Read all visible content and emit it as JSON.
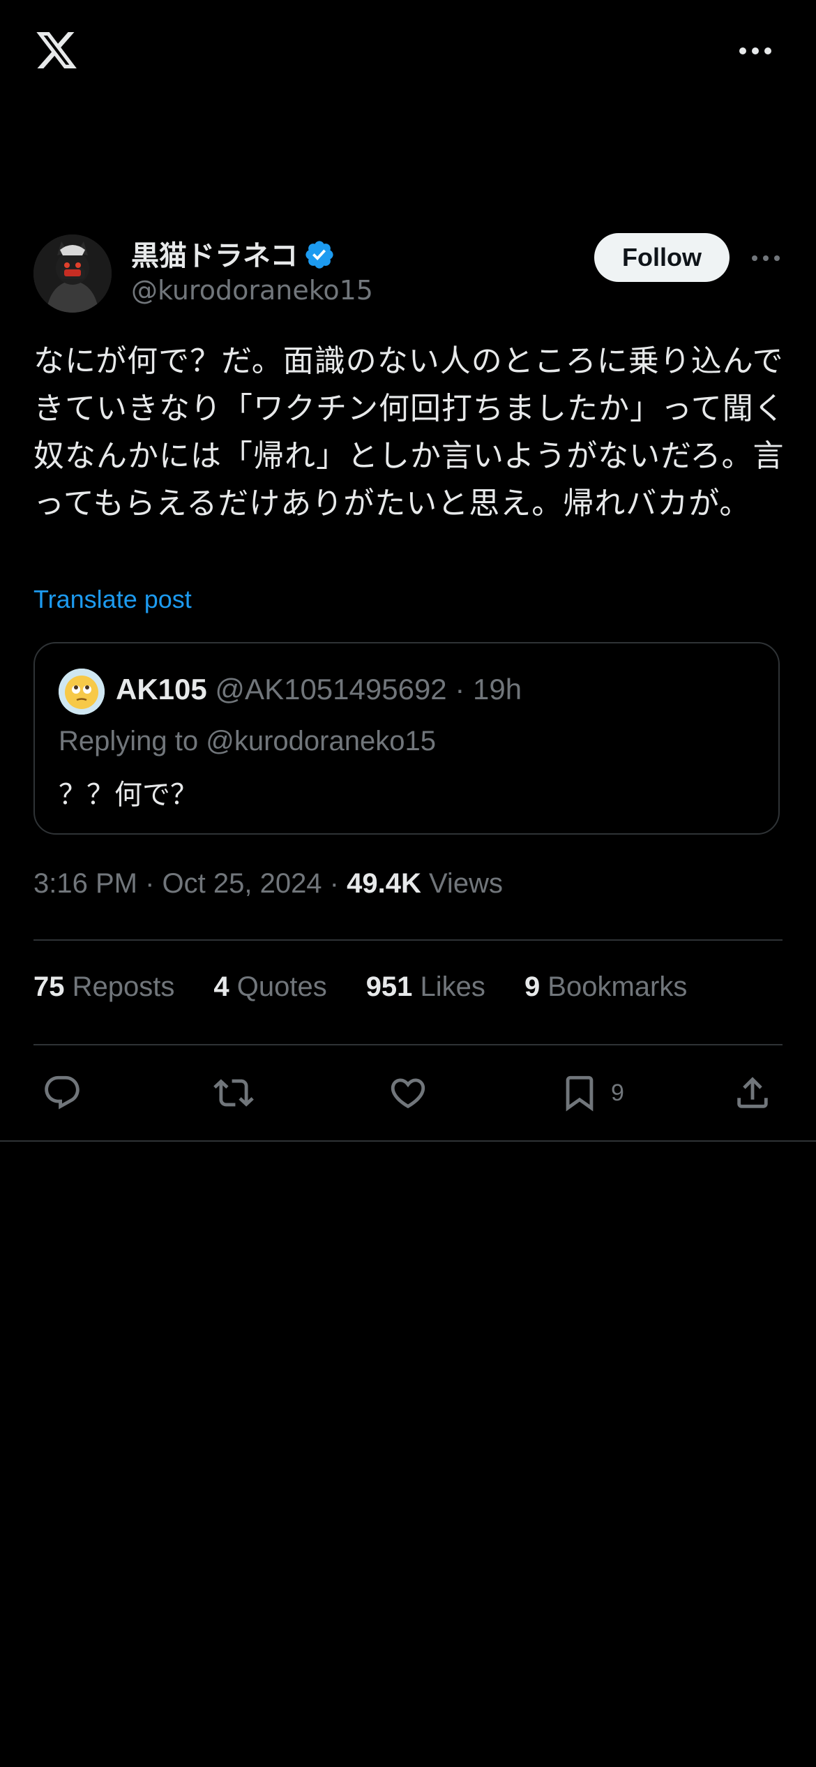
{
  "topbar": {
    "logo": "x-logo",
    "more": "more-horizontal-icon"
  },
  "author": {
    "name": "黒猫ドラネコ",
    "handle": "@kurodoraneko15",
    "verified": true,
    "follow_label": "Follow"
  },
  "tweet": {
    "text": "なにが何で？だ。面識のない人のところに乗り込んできていきなり「ワクチン何回打ちましたか」って聞く奴なんかには「帰れ」としか言いようがないだろ。言ってもらえるだけありがたいと思え。帰れバカが。",
    "translate_label": "Translate post"
  },
  "quote": {
    "name": "AK105",
    "handle": "@AK1051495692",
    "separator": "·",
    "time": "19h",
    "replying_to": "Replying to @kurodoraneko15",
    "text": "？？何で？"
  },
  "meta": {
    "time": "3:16 PM · Oct 25, 2024 · ",
    "views_count": "49.4K",
    "views_label": " Views"
  },
  "stats": [
    {
      "num": "75",
      "label": " Reposts"
    },
    {
      "num": "4",
      "label": " Quotes"
    },
    {
      "num": "951",
      "label": " Likes"
    },
    {
      "num": "9",
      "label": " Bookmarks"
    }
  ],
  "actions": {
    "bookmark_count": "9",
    "icons": [
      "reply-icon",
      "repost-icon",
      "like-icon",
      "bookmark-icon",
      "share-icon"
    ]
  },
  "colors": {
    "background": "#000000",
    "text": "#e7e9ea",
    "muted": "#71767b",
    "link": "#1d9bf0",
    "verified": "#1d9bf0",
    "border": "#2f3336"
  }
}
